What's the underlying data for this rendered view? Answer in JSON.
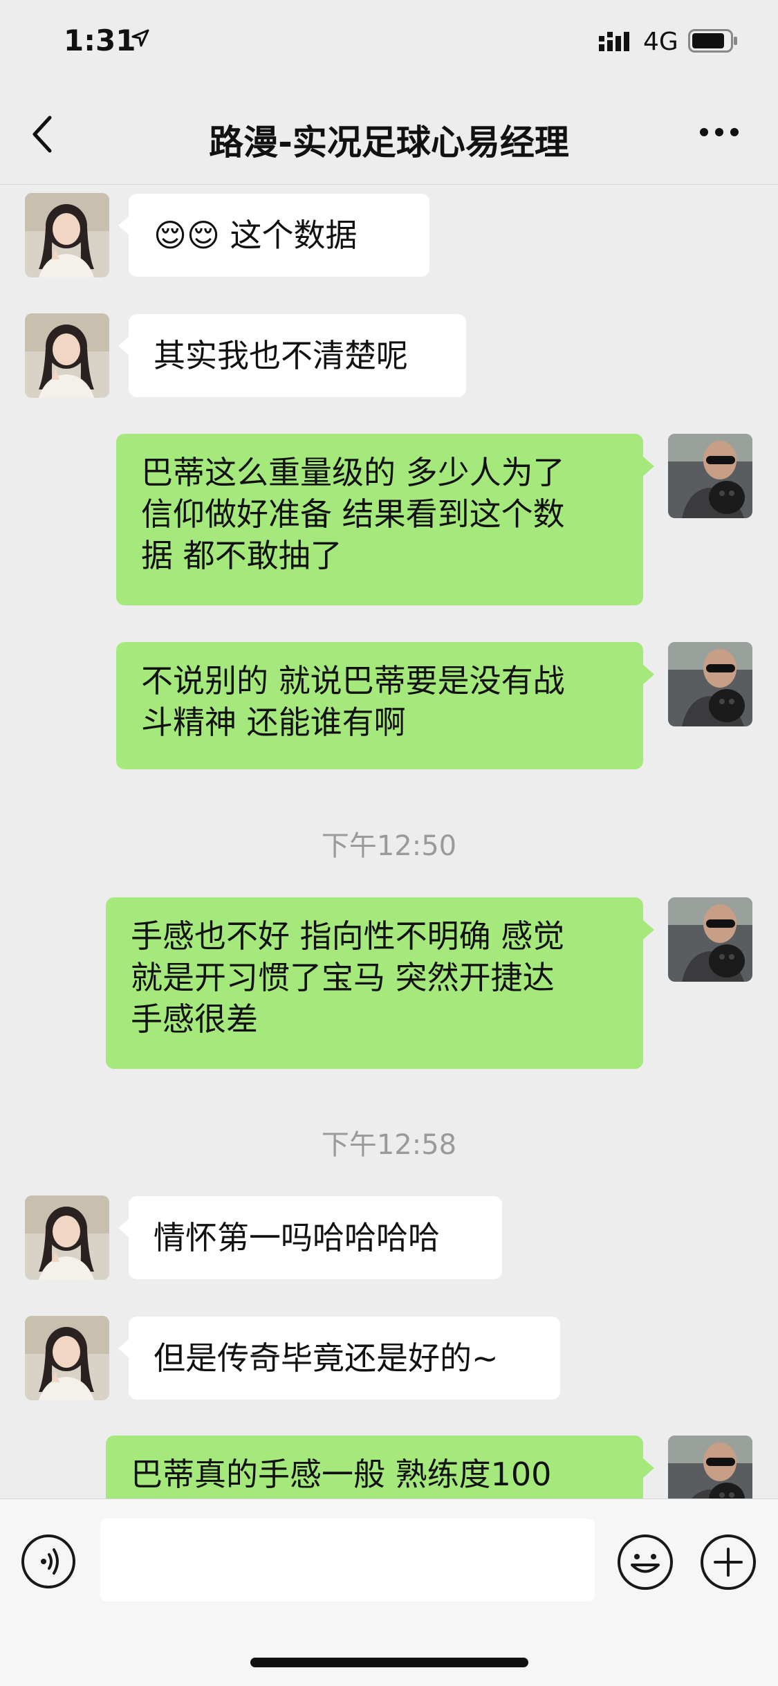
{
  "status_bar": {
    "time": "1:31",
    "network": "4G"
  },
  "nav": {
    "title": "路漫-实况足球心易经理"
  },
  "messages": [
    {
      "text": "😌😌 这个数据"
    },
    {
      "text": "其实我也不清楚呢"
    },
    {
      "line1": "巴蒂这么重量级的 多少人为了",
      "line2": "信仰做好准备 结果看到这个数",
      "line3": "据 都不敢抽了"
    },
    {
      "line1": "不说别的 就说巴蒂要是没有战",
      "line2": "斗精神 还能谁有啊"
    },
    {
      "line1": "手感也不好 指向性不明确 感觉",
      "line2": "就是开习惯了宝马 突然开捷达",
      "line3": "手感很差"
    },
    {
      "text": "情怀第一吗哈哈哈哈"
    },
    {
      "text": "但是传奇毕竟还是好的~"
    },
    {
      "line1": "巴蒂真的手感一般 熟练度100"
    }
  ],
  "timestamps": [
    "下午12:50",
    "下午12:58"
  ],
  "input": {
    "value": ""
  }
}
